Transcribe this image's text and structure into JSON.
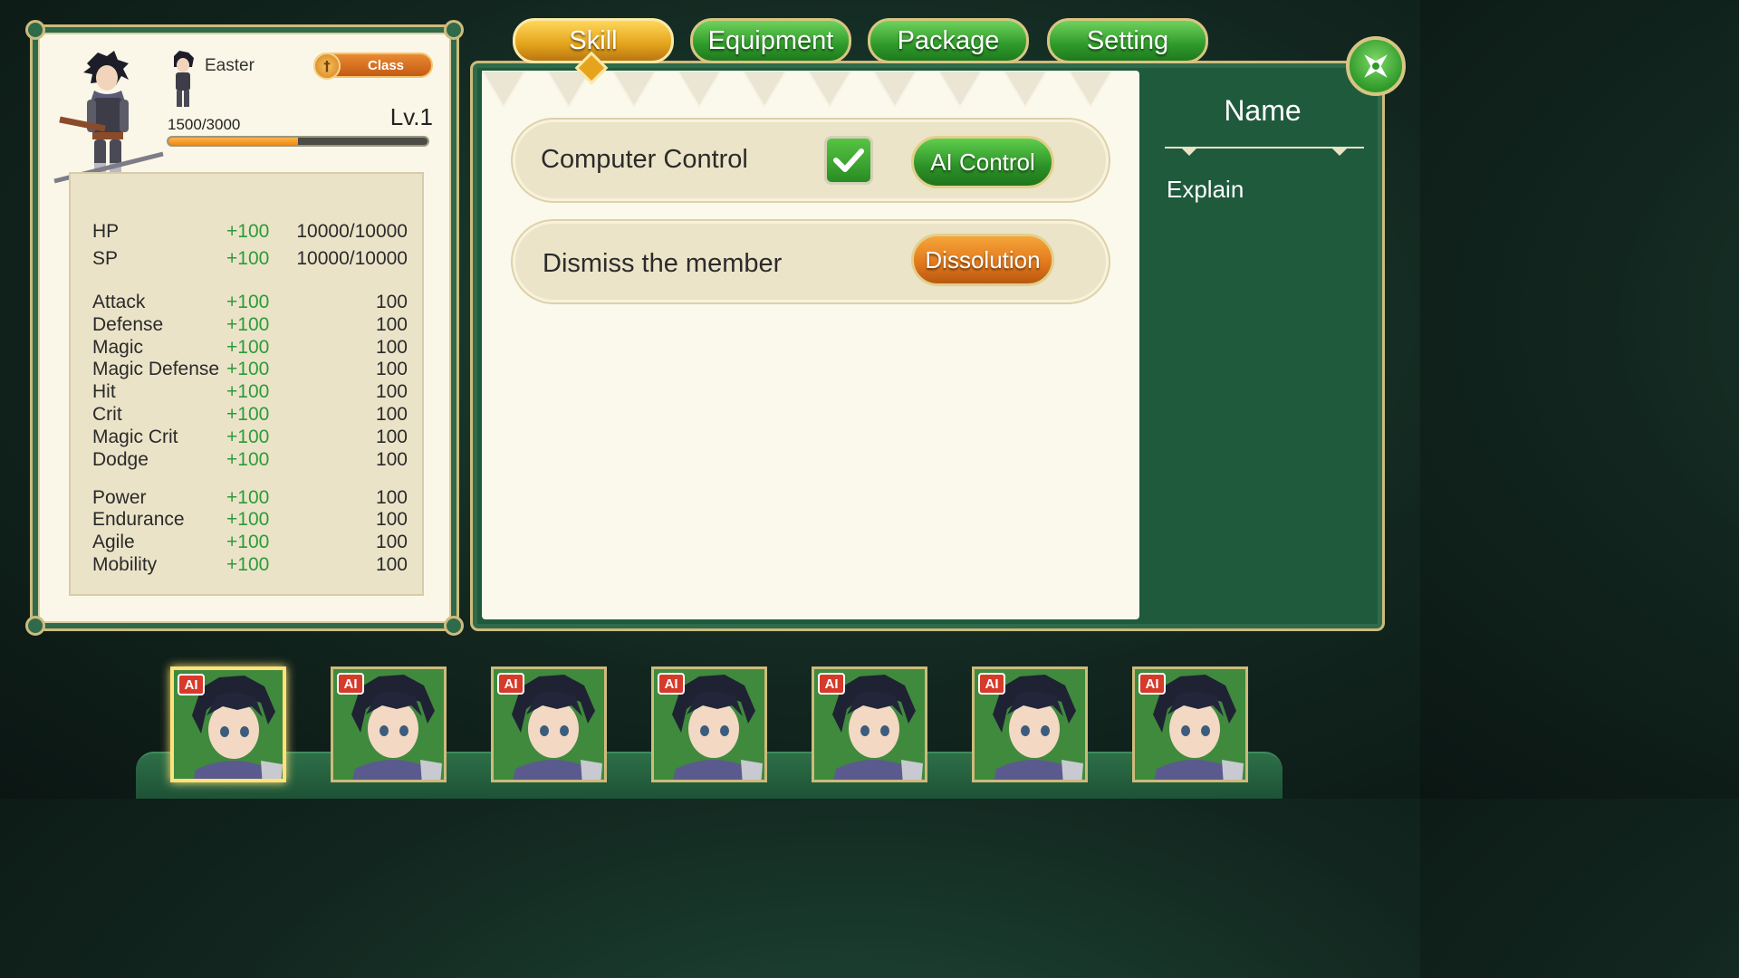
{
  "character": {
    "name": "Easter",
    "class_label": "Class",
    "exp_text": "1500/3000",
    "exp_progress": 0.5,
    "level_text": "Lv.1"
  },
  "stats": [
    {
      "name": "HP",
      "bonus": "+100",
      "value": "10000/10000"
    },
    {
      "name": "SP",
      "bonus": "+100",
      "value": "10000/10000"
    },
    {
      "name": "Attack",
      "bonus": "+100",
      "value": "100"
    },
    {
      "name": "Defense",
      "bonus": "+100",
      "value": "100"
    },
    {
      "name": "Magic",
      "bonus": "+100",
      "value": "100"
    },
    {
      "name": "Magic Defense",
      "bonus": "+100",
      "value": "100"
    },
    {
      "name": "Hit",
      "bonus": "+100",
      "value": "100"
    },
    {
      "name": "Crit",
      "bonus": "+100",
      "value": "100"
    },
    {
      "name": "Magic Crit",
      "bonus": "+100",
      "value": "100"
    },
    {
      "name": "Dodge",
      "bonus": "+100",
      "value": "100"
    },
    {
      "name": "Power",
      "bonus": "+100",
      "value": "100"
    },
    {
      "name": "Endurance",
      "bonus": "+100",
      "value": "100"
    },
    {
      "name": "Agile",
      "bonus": "+100",
      "value": "100"
    },
    {
      "name": "Mobility",
      "bonus": "+100",
      "value": "100"
    }
  ],
  "tabs": [
    {
      "label": "Skill",
      "active": true
    },
    {
      "label": "Equipment",
      "active": false
    },
    {
      "label": "Package",
      "active": false
    },
    {
      "label": "Setting",
      "active": false
    }
  ],
  "settings": {
    "computer_control_label": "Computer Control",
    "computer_control_checked": true,
    "ai_control_label": "AI Control",
    "dismiss_label": "Dismiss the member",
    "dissolution_label": "Dissolution"
  },
  "info_panel": {
    "title": "Name",
    "explain": "Explain"
  },
  "party": {
    "ai_badge": "AI",
    "selected_index": 0,
    "count": 7
  },
  "colors": {
    "panel_green": "#2f6a4b",
    "gold_trim": "#cdbb7c",
    "bonus_green": "#2c9b3a",
    "active_tab": "#e3a21a",
    "ai_badge_red": "#d63a2a"
  },
  "icons": {
    "close": "close-star-icon",
    "class": "sword-icon",
    "checkbox": "checkmark-icon"
  }
}
